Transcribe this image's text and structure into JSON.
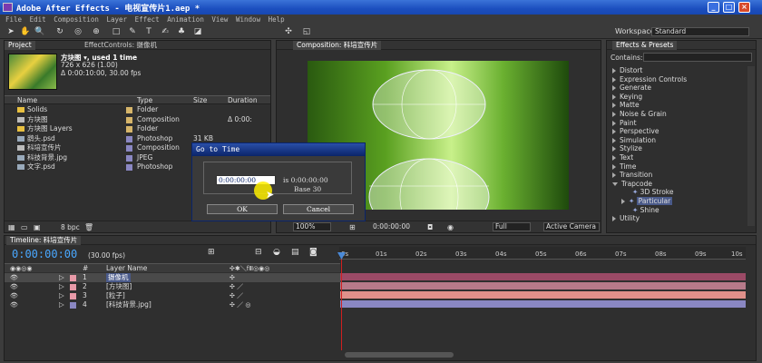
{
  "window": {
    "title": "Adobe After Effects - 电视宣传片1.aep *",
    "min": "_",
    "max": "□",
    "close": "×"
  },
  "menu": [
    "File",
    "Edit",
    "Composition",
    "Layer",
    "Effect",
    "Animation",
    "View",
    "Window",
    "Help"
  ],
  "toolbar": {
    "workspace_label": "Workspace:",
    "workspace_value": "Standard"
  },
  "project": {
    "tab_project": "Project",
    "tab_effect_controls": "EffectControls: 摄像机",
    "selected_name": "方块图 ▾, used 1 time",
    "selected_dims": "726 x 626 (1.00)",
    "selected_duration": "Δ 0:00:10:00, 30.00 fps",
    "headers": {
      "name": "Name",
      "type": "Type",
      "size": "Size",
      "duration": "Duration"
    },
    "items": [
      {
        "name": "Solids",
        "type": "Folder",
        "size": "",
        "duration": "",
        "icon": "folder",
        "color": "#d6b56a"
      },
      {
        "name": "方块图",
        "type": "Composition",
        "size": "",
        "duration": "Δ 0:00:",
        "icon": "comp",
        "color": "#d6b56a"
      },
      {
        "name": "方块图 Layers",
        "type": "Folder",
        "size": "",
        "duration": "",
        "icon": "folder",
        "color": "#d6b56a"
      },
      {
        "name": "鹞头.psd",
        "type": "Photoshop",
        "size": "31 KB",
        "duration": "",
        "icon": "psd",
        "color": "#8a87c2"
      },
      {
        "name": "科培宣传片",
        "type": "Composition",
        "size": "",
        "duration": "",
        "icon": "comp",
        "color": "#8a87c2"
      },
      {
        "name": "科技背景.jpg",
        "type": "JPEG",
        "size": "",
        "duration": "",
        "icon": "jpg",
        "color": "#8a87c2"
      },
      {
        "name": "文字.psd",
        "type": "Photoshop",
        "size": "",
        "duration": "",
        "icon": "psd",
        "color": "#8a87c2"
      }
    ],
    "bpc": "8 bpc"
  },
  "composition": {
    "tab": "Composition: 科培宣传片",
    "zoom": "100%",
    "timecode": "0:00:00:00",
    "resolution": "Full",
    "camera": "Active Camera"
  },
  "effects": {
    "tab": "Effects & Presets",
    "contains_label": "Contains:",
    "categories": [
      {
        "label": "Distort",
        "expanded": false,
        "indent": 0
      },
      {
        "label": "Expression Controls",
        "expanded": false,
        "indent": 0
      },
      {
        "label": "Generate",
        "expanded": false,
        "indent": 0
      },
      {
        "label": "Keying",
        "expanded": false,
        "indent": 0
      },
      {
        "label": "Matte",
        "expanded": false,
        "indent": 0
      },
      {
        "label": "Noise & Grain",
        "expanded": false,
        "indent": 0
      },
      {
        "label": "Paint",
        "expanded": false,
        "indent": 0
      },
      {
        "label": "Perspective",
        "expanded": false,
        "indent": 0
      },
      {
        "label": "Simulation",
        "expanded": false,
        "indent": 0
      },
      {
        "label": "Stylize",
        "expanded": false,
        "indent": 0
      },
      {
        "label": "Text",
        "expanded": false,
        "indent": 0
      },
      {
        "label": "Time",
        "expanded": false,
        "indent": 0
      },
      {
        "label": "Transition",
        "expanded": false,
        "indent": 0
      },
      {
        "label": "Trapcode",
        "expanded": true,
        "indent": 0
      },
      {
        "label": "3D Stroke",
        "expanded": null,
        "indent": 1
      },
      {
        "label": "Particular",
        "expanded": null,
        "indent": 1,
        "selected": true
      },
      {
        "label": "Shine",
        "expanded": null,
        "indent": 1
      },
      {
        "label": "Utility",
        "expanded": false,
        "indent": 0
      }
    ]
  },
  "timeline": {
    "tab": "Timeline: 科培宣传片",
    "timecode": "0:00:00:00",
    "fps": "(30.00 fps)",
    "layer_name_header": "Layer Name",
    "num_header": "#",
    "ticks": [
      "0s",
      "01s",
      "02s",
      "03s",
      "04s",
      "05s",
      "06s",
      "07s",
      "08s",
      "09s",
      "10s"
    ],
    "layers": [
      {
        "num": "1",
        "name": "摄像机",
        "color": "#e89aa8",
        "bar": "#9b4a66",
        "selected": true
      },
      {
        "num": "2",
        "name": "[方块图]",
        "color": "#e89aa8",
        "bar": "#b77a8a",
        "selected": false
      },
      {
        "num": "3",
        "name": "[粒子]",
        "color": "#e89aa8",
        "bar": "#e0908a",
        "selected": false
      },
      {
        "num": "4",
        "name": "[科技背景.jpg]",
        "color": "#8a87c2",
        "bar": "#8a87c2",
        "selected": false
      }
    ]
  },
  "dialog": {
    "title": "Go to Time",
    "value": "0:00:00:00",
    "is_text": "is 0:00:00:00",
    "base_text": "Base 30",
    "ok": "OK",
    "cancel": "Cancel"
  },
  "colors": {
    "accent": "#2a4fa8",
    "playhead": "#d02020",
    "selection": "#4a5a8a"
  }
}
